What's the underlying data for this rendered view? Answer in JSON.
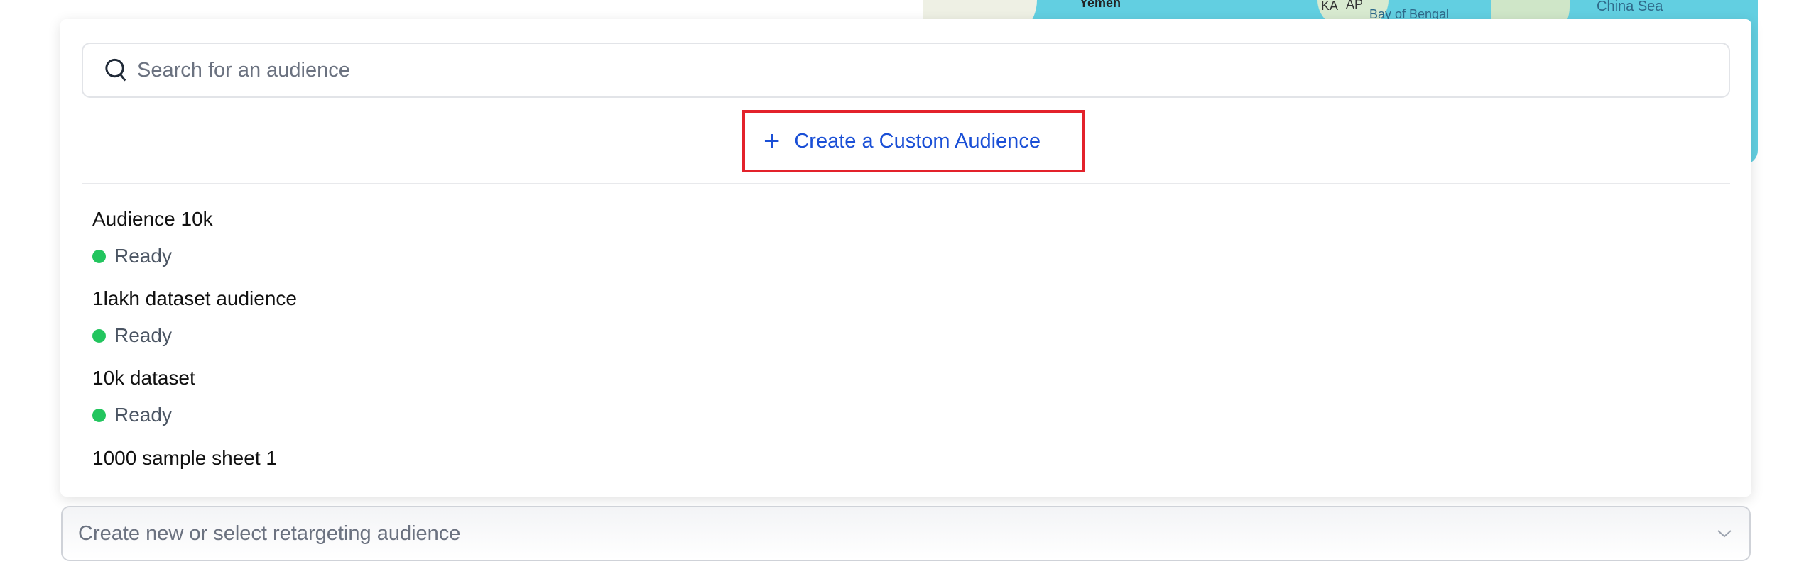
{
  "map": {
    "labels": [
      "Yemen",
      "KA",
      "AP",
      "Bay of Bengal",
      "China Sea"
    ]
  },
  "search": {
    "placeholder": "Search for an audience",
    "icon": "search-icon"
  },
  "create_button": {
    "label": "Create a Custom Audience",
    "icon": "plus-icon",
    "color": "#1a4fd6"
  },
  "audiences": [
    {
      "name": "Audience 10k",
      "status": "Ready"
    },
    {
      "name": "1lakh dataset audience",
      "status": "Ready"
    },
    {
      "name": "10k dataset",
      "status": "Ready"
    },
    {
      "name": "1000 sample sheet 1"
    }
  ],
  "status_color": "#22c55e",
  "retargeting_select": {
    "placeholder": "Create new or select retargeting audience",
    "icon": "chevron-down-icon"
  }
}
